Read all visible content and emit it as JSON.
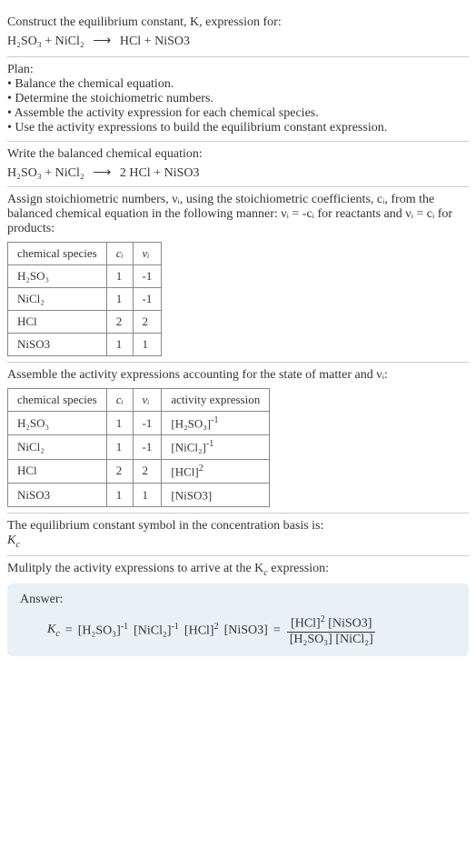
{
  "question": {
    "prompt": "Construct the equilibrium constant, K, expression for:",
    "equation_lhs": "H₂SO₃ + NiCl₂",
    "equation_rhs": "HCl + NiSO3"
  },
  "plan": {
    "heading": "Plan:",
    "items": [
      "• Balance the chemical equation.",
      "• Determine the stoichiometric numbers.",
      "• Assemble the activity expression for each chemical species.",
      "• Use the activity expressions to build the equilibrium constant expression."
    ]
  },
  "balanced": {
    "heading": "Write the balanced chemical equation:",
    "lhs": "H₂SO₃ + NiCl₂",
    "rhs": "2 HCl + NiSO3"
  },
  "stoich_intro": "Assign stoichiometric numbers, νᵢ, using the stoichiometric coefficients, cᵢ, from the balanced chemical equation in the following manner: νᵢ = -cᵢ for reactants and νᵢ = cᵢ for products:",
  "table1": {
    "headers": [
      "chemical species",
      "cᵢ",
      "νᵢ"
    ],
    "rows": [
      [
        "H₂SO₃",
        "1",
        "-1"
      ],
      [
        "NiCl₂",
        "1",
        "-1"
      ],
      [
        "HCl",
        "2",
        "2"
      ],
      [
        "NiSO3",
        "1",
        "1"
      ]
    ]
  },
  "activity_intro": "Assemble the activity expressions accounting for the state of matter and νᵢ:",
  "table2": {
    "headers": [
      "chemical species",
      "cᵢ",
      "νᵢ",
      "activity expression"
    ],
    "rows": [
      {
        "sp": "H₂SO₃",
        "c": "1",
        "v": "-1",
        "ae_base": "[H₂SO₃]",
        "ae_exp": "-1"
      },
      {
        "sp": "NiCl₂",
        "c": "1",
        "v": "-1",
        "ae_base": "[NiCl₂]",
        "ae_exp": "-1"
      },
      {
        "sp": "HCl",
        "c": "2",
        "v": "2",
        "ae_base": "[HCl]",
        "ae_exp": "2"
      },
      {
        "sp": "NiSO3",
        "c": "1",
        "v": "1",
        "ae_base": "[NiSO3]",
        "ae_exp": ""
      }
    ]
  },
  "kc_symbol_intro": "The equilibrium constant symbol in the concentration basis is:",
  "kc_symbol": "K",
  "kc_symbol_sub": "c",
  "multiply_intro": "Mulitply the activity expressions to arrive at the K",
  "multiply_intro_sub": "c",
  "multiply_intro_tail": " expression:",
  "answer": {
    "label": "Answer:",
    "kc": "K",
    "kc_sub": "c",
    "terms": {
      "t1_base": "[H₂SO₃]",
      "t1_exp": "-1",
      "t2_base": "[NiCl₂]",
      "t2_exp": "-1",
      "t3_base": "[HCl]",
      "t3_exp": "2",
      "t4_base": "[NiSO3]",
      "num1_base": "[HCl]",
      "num1_exp": "2",
      "num2": "[NiSO3]",
      "den1": "[H₂SO₃]",
      "den2": "[NiCl₂]"
    }
  }
}
